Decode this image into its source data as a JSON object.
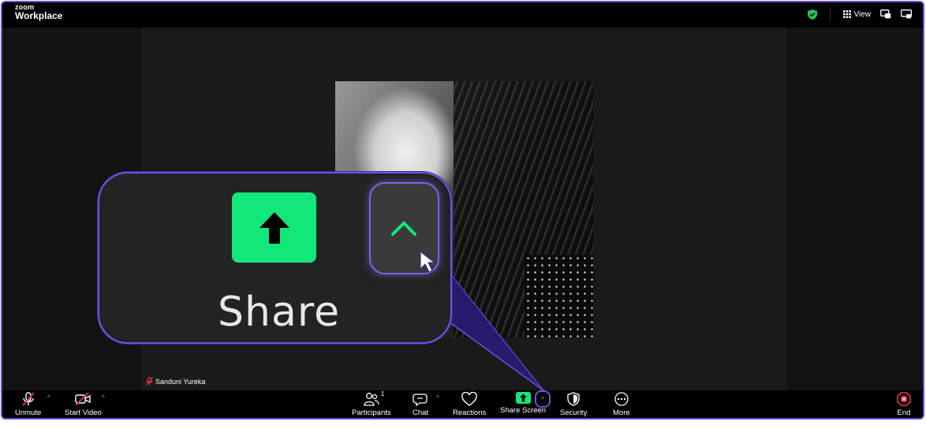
{
  "app": {
    "brand_top": "zoom",
    "brand_bottom": "Workplace"
  },
  "topbar": {
    "view_label": "View",
    "icons": [
      "shield-check-icon",
      "grid-view-icon",
      "speaker-view-icon",
      "fullscreen-icon"
    ]
  },
  "participant": {
    "name": "Sanduni Yureka",
    "muted": true
  },
  "zoom_callout": {
    "label": "Share",
    "icons": [
      "share-arrow-icon",
      "caret-up-icon",
      "mouse-pointer-icon"
    ]
  },
  "toolbar": {
    "unmute": "Unmute",
    "start_video": "Start Video",
    "participants": "Participants",
    "participants_count": "1",
    "chat": "Chat",
    "reactions": "Reactions",
    "share_screen": "Share Screen",
    "security": "Security",
    "more": "More",
    "end": "End"
  },
  "colors": {
    "accent_purple": "#6e55e0",
    "share_green": "#12e87a",
    "end_red": "#e5334a",
    "shield_green": "#20c35a"
  }
}
